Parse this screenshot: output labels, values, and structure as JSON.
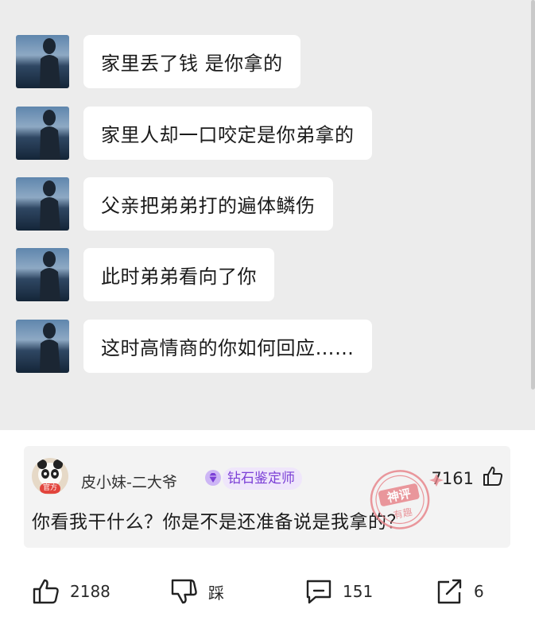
{
  "chat": {
    "messages": [
      {
        "text": "家里丢了钱  是你拿的"
      },
      {
        "text": "家里人却一口咬定是你弟拿的"
      },
      {
        "text": "父亲把弟弟打的遍体鳞伤"
      },
      {
        "text": "此时弟弟看向了你"
      },
      {
        "text": "这时高情商的你如何回应……"
      }
    ]
  },
  "comment": {
    "avatar_badge": "官方",
    "username": "皮小妹-二大爷",
    "title_badge": "钻石鉴定师",
    "likes": "7161",
    "text": "你看我干什么？你是不是还准备说是我拿的？",
    "stamp": {
      "line1": "神评",
      "line2": "有趣"
    }
  },
  "actions": {
    "like_count": "2188",
    "dislike_label": "踩",
    "comment_count": "151",
    "share_count": "6"
  },
  "colors": {
    "chat_background": "#ececec",
    "bubble": "#ffffff",
    "badge_text": "#7b3fd6",
    "stamp": "#e8868c"
  }
}
